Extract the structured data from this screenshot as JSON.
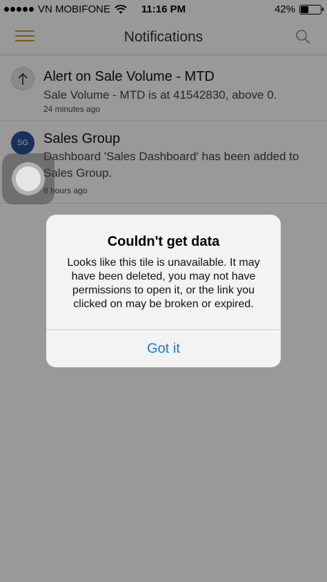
{
  "status_bar": {
    "carrier": "VN MOBIFONE",
    "time": "11:16 PM",
    "battery_percent": "42%",
    "battery_level": 0.42,
    "signal_icon": "signal-dots-icon",
    "wifi_icon": "wifi-icon",
    "battery_icon": "battery-icon"
  },
  "nav": {
    "title": "Notifications",
    "menu_icon": "hamburger-menu-icon",
    "search_icon": "search-icon",
    "accent_color": "#c79a1e"
  },
  "notifications": [
    {
      "icon": "arrow-up-icon",
      "title": "Alert on Sale Volume - MTD",
      "body": "Sale Volume - MTD is at 41542830, above 0.",
      "time": "24 minutes ago"
    },
    {
      "avatar_text": "SG",
      "avatar_color": "#2a4f9a",
      "title": "Sales Group",
      "body": "Dashboard 'Sales Dashboard' has been added to Sales Group.",
      "time": "8 hours ago"
    }
  ],
  "alert": {
    "title": "Couldn't get data",
    "message": "Looks like this tile is unavailable. It may have been deleted, you may not have permissions to open it, or the link you clicked on may be broken or expired.",
    "button_label": "Got it",
    "button_color": "#1a7bd6"
  }
}
